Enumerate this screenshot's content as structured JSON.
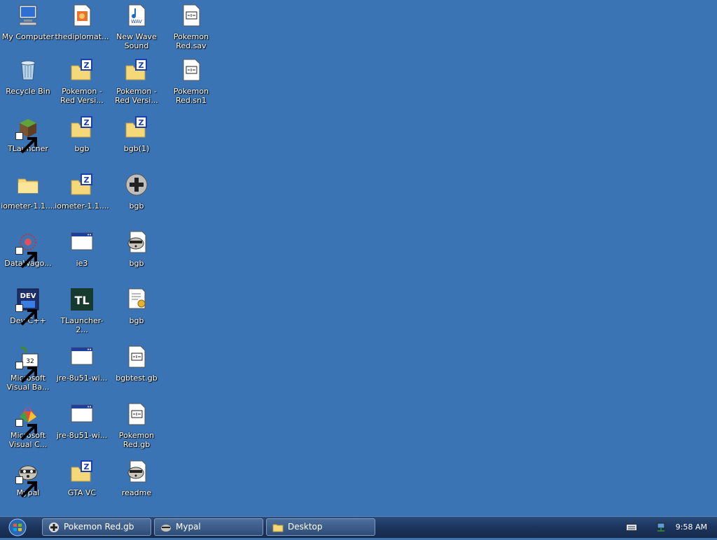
{
  "desktop": {
    "icons": {
      "my_computer": "My Computer",
      "thediplomat": "thediplomat...",
      "new_wave_sound": "New Wave Sound",
      "pokemon_sav": "Pokemon Red.sav",
      "recycle_bin": "Recycle Bin",
      "pokemon_red_versi_1": "Pokemon - Red Versi...",
      "pokemon_red_versi_2": "Pokemon - Red Versi...",
      "pokemon_sn1": "Pokemon Red.sn1",
      "tlauncher": "TLauncher",
      "bgb_zip_1": "bgb",
      "bgb_zip_2": "bgb(1)",
      "iometer_folder": "iometer-1.1....",
      "iometer_zip": "iometer-1.1....",
      "bgb_exe": "bgb",
      "datawago": "DataWago...",
      "ie3": "ie3",
      "bgb_raccoon": "bgb",
      "devcpp": "Dev-C++",
      "tlauncher2": "TLauncher-2...",
      "bgb_notes": "bgb",
      "ms_visual_basic": "Microsoft Visual Ba...",
      "jre_1": "jre-8u51-wi...",
      "bgbtest": "bgbtest.gb",
      "ms_visual_c": "Microsoft Visual C...",
      "jre_2": "jre-8u51-wi...",
      "pokemon_gb": "Pokemon Red.gb",
      "mypal": "Mypal",
      "gta_vc": "GTA VC",
      "readme": "readme"
    }
  },
  "taskbar": {
    "tasks": [
      "Pokemon Red.gb",
      "Mypal",
      "Desktop"
    ],
    "clock": "9:58 AM"
  },
  "colors": {
    "desktop_bg": "#3b74b4",
    "taskbar": "#1c3660"
  }
}
